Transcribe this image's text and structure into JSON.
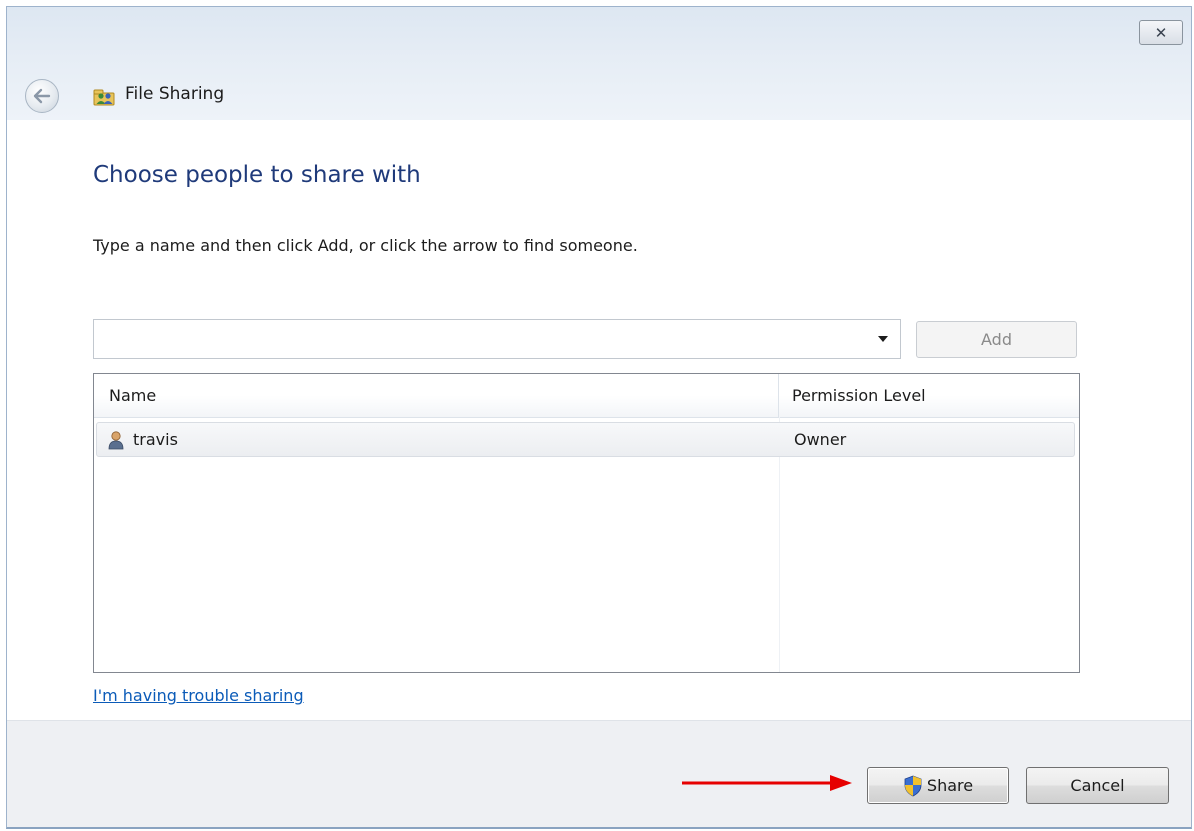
{
  "window": {
    "title": "File Sharing",
    "close_label": "✕"
  },
  "main": {
    "heading": "Choose people to share with",
    "instruction": "Type a name and then click Add, or click the arrow to find someone.",
    "name_input": {
      "value": "",
      "placeholder": ""
    },
    "add_label": "Add",
    "columns": {
      "name": "Name",
      "permission": "Permission Level"
    },
    "rows": [
      {
        "name": "travis",
        "permission": "Owner"
      }
    ],
    "trouble_link": "I'm having trouble sharing"
  },
  "footer": {
    "share_label": "Share",
    "cancel_label": "Cancel"
  },
  "colors": {
    "heading": "#1f3a7a",
    "link": "#0b5bb8",
    "annotation_arrow": "#e60000"
  }
}
